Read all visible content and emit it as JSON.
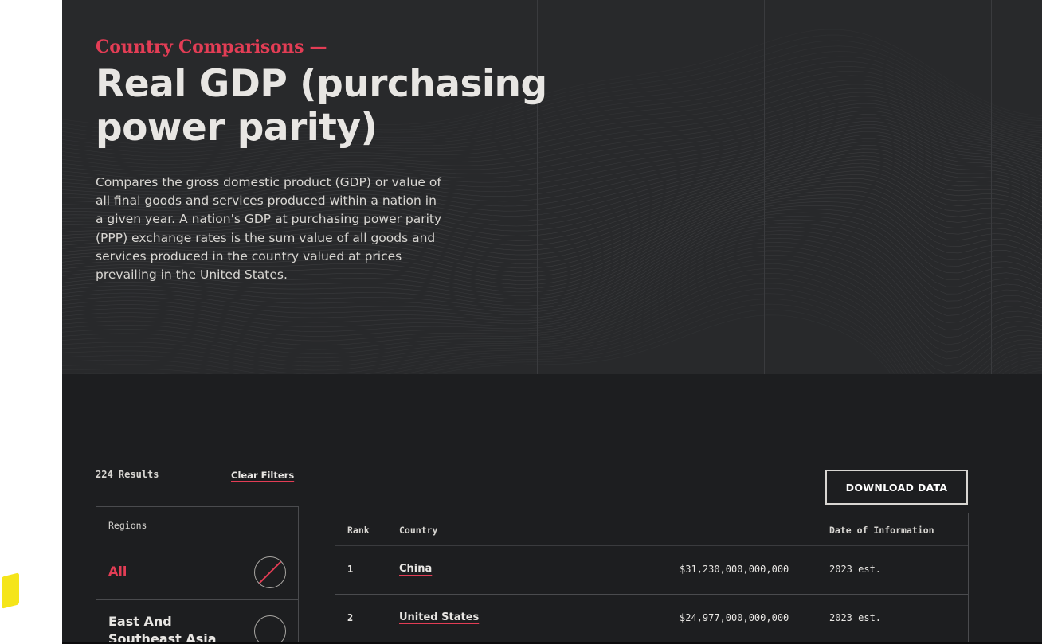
{
  "hero": {
    "eyebrow": "Country Comparisons —",
    "title": "Real GDP (purchasing power parity)",
    "description": "Compares the gross domestic product (GDP) or value of all final goods and services produced within a nation in a given year. A nation's GDP at purchasing power parity (PPP) exchange rates is the sum value of all goods and services produced in the country valued at prices prevailing in the United States."
  },
  "filters": {
    "results": "224 Results",
    "clear_label": "Clear Filters",
    "regions_title": "Regions",
    "items": [
      {
        "label": "All",
        "selected": true
      },
      {
        "label": "East And Southeast Asia",
        "selected": false
      }
    ]
  },
  "actions": {
    "download_label": "DOWNLOAD DATA"
  },
  "table": {
    "headers": {
      "rank": "Rank",
      "country": "Country",
      "date": "Date of Information"
    },
    "rows": [
      {
        "rank": "1",
        "country": "China",
        "value": "$31,230,000,000,000",
        "date": "2023 est."
      },
      {
        "rank": "2",
        "country": "United States",
        "value": "$24,977,000,000,000",
        "date": "2023 est."
      }
    ]
  },
  "colors": {
    "accent": "#e33d55",
    "hero_bg": "#28292b",
    "page_bg": "#1d1e20",
    "badge": "#f5e51a"
  }
}
